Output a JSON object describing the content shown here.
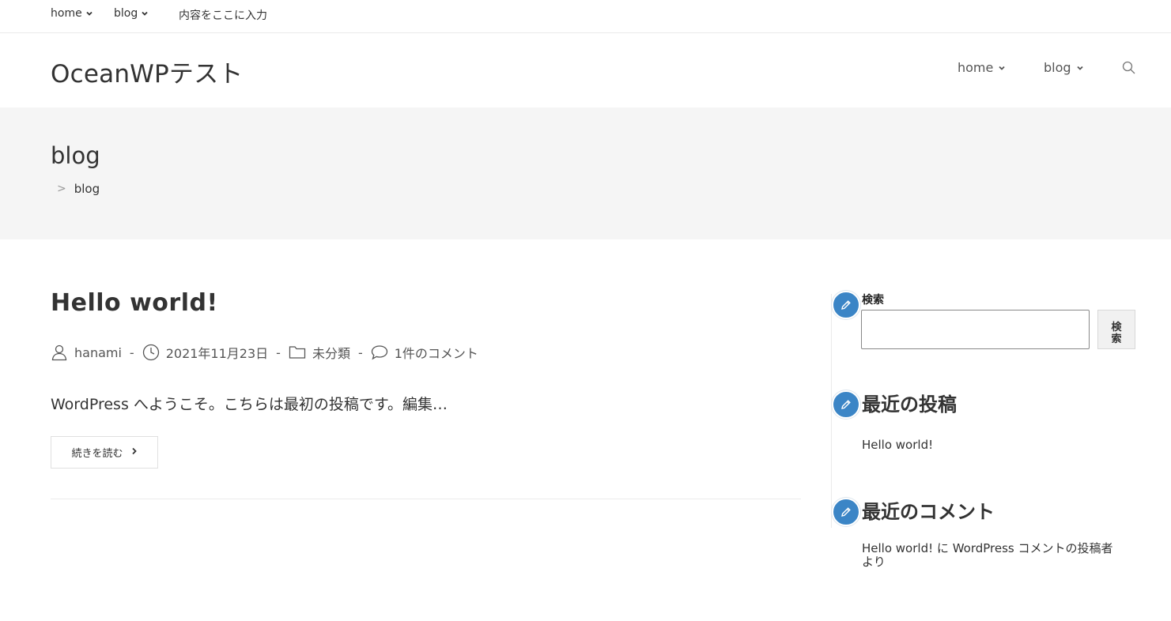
{
  "topbar": {
    "items": [
      {
        "label": "home",
        "has_dropdown": true
      },
      {
        "label": "blog",
        "has_dropdown": true
      },
      {
        "label": "内容をここに入力",
        "has_dropdown": false
      }
    ]
  },
  "header": {
    "site_title": "OceanWPテスト",
    "nav": [
      {
        "label": "home",
        "has_dropdown": true
      },
      {
        "label": "blog",
        "has_dropdown": true
      }
    ],
    "search_icon": "search-icon"
  },
  "page_header": {
    "title": "blog",
    "breadcrumb": {
      "separator": ">",
      "current": "blog"
    }
  },
  "post": {
    "title": "Hello world!",
    "meta": {
      "author": "hanami",
      "date": "2021年11月23日",
      "category": "未分類",
      "comments": "1件のコメント",
      "separator": "-"
    },
    "excerpt": "WordPress へようこそ。こちらは最初の投稿です。編集…",
    "read_more": "続きを読む"
  },
  "sidebar": {
    "search": {
      "label": "検索",
      "button_line1": "検",
      "button_line2": "索",
      "value": ""
    },
    "recent_posts": {
      "heading": "最近の投稿",
      "items": [
        "Hello world!"
      ]
    },
    "recent_comments": {
      "heading": "最近のコメント",
      "items": [
        {
          "post": "Hello world!",
          "connector": "に",
          "author": "WordPress コメントの投稿者",
          "suffix": "より"
        }
      ]
    }
  },
  "colors": {
    "accent_blue": "#3b85c6",
    "band_gray": "#f5f5f5",
    "text": "#333333"
  }
}
